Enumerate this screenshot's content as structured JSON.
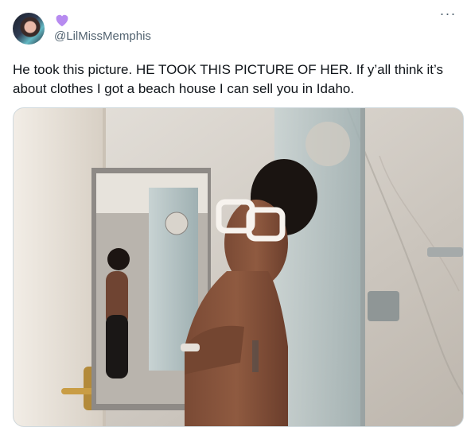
{
  "user": {
    "handle": "@LilMissMemphis",
    "avatar_icon": "profile-photo",
    "badge_icon": "purple-heart-icon",
    "badge_color": "#b78bf0"
  },
  "menu": {
    "more_label": "···"
  },
  "tweet": {
    "text": "He took this picture. HE TOOK THIS PICTURE OF HER. If y’all think it’s about clothes I got a beach house I can sell you in Idaho."
  },
  "media": {
    "kind": "photo",
    "subject": "bathroom-mirror-photo"
  }
}
